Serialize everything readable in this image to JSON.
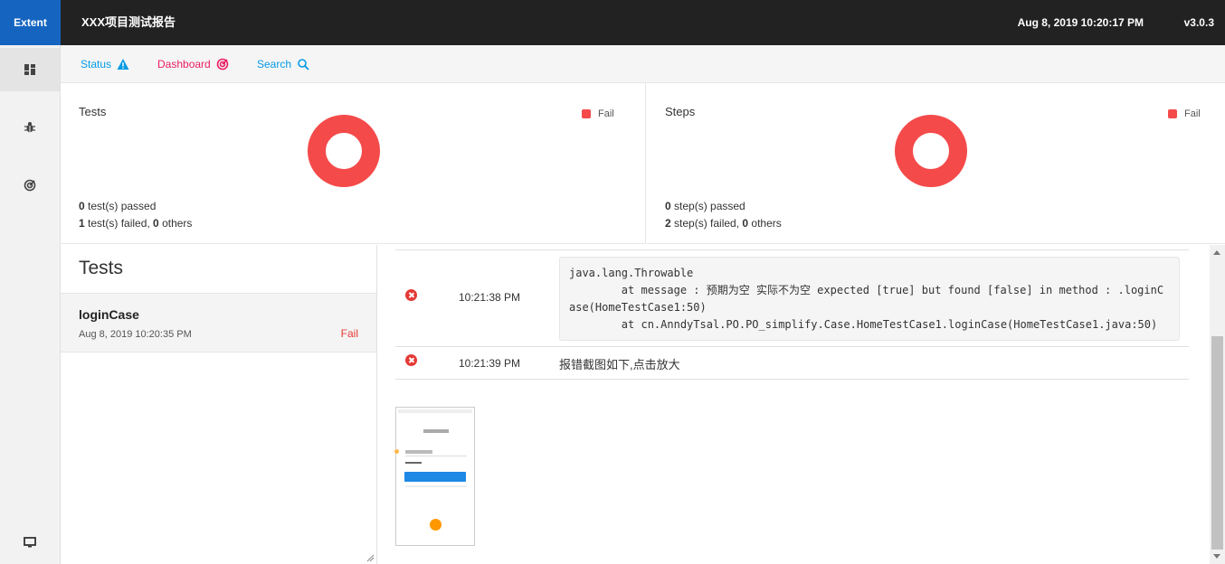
{
  "header": {
    "brand": "Extent",
    "title": "XXX项目测试报告",
    "date": "Aug 8, 2019 10:20:17 PM",
    "version": "v3.0.3"
  },
  "sidebar": {
    "items": [
      {
        "icon": "dashboard-icon"
      },
      {
        "icon": "bug-icon"
      },
      {
        "icon": "radar-icon"
      },
      {
        "icon": "monitor-icon"
      }
    ]
  },
  "nav": {
    "status_label": "Status",
    "dashboard_label": "Dashboard",
    "search_label": "Search",
    "colors": {
      "status": "#039be5",
      "dashboard": "#e91e63",
      "search": "#039be5"
    }
  },
  "tests_panel": {
    "title": "Tests",
    "legend": "Fail",
    "passed_count": "0",
    "passed_text": " test(s) passed",
    "failed_count": "1",
    "failed_text": " test(s) failed, ",
    "others_count": "0",
    "others_text": " others",
    "fail_fraction": 1.0
  },
  "steps_panel": {
    "title": "Steps",
    "legend": "Fail",
    "passed_count": "0",
    "passed_text": " step(s) passed",
    "failed_count": "2",
    "failed_text": " step(s) failed, ",
    "others_count": "0",
    "others_text": " others",
    "fail_fraction": 1.0
  },
  "fail_color": "#f44a4a",
  "tests_list": {
    "heading": "Tests",
    "items": [
      {
        "name": "loginCase",
        "time": "Aug 8, 2019 10:20:35 PM",
        "status": "Fail"
      }
    ]
  },
  "log": [
    {
      "time": "10:21:38 PM",
      "status_icon": "error-icon",
      "details": "java.lang.Throwable\n\tat message : 预期为空 实际不为空 expected [true] but found [false] in method : .loginC\nase(HomeTestCase1:50)\n\tat cn.AnndyTsal.PO.PO_simplify.Case.HomeTestCase1.loginCase(HomeTestCase1.java:50)"
    },
    {
      "time": "10:21:39 PM",
      "status_icon": "error-icon",
      "details": "报错截图如下,点击放大"
    }
  ]
}
